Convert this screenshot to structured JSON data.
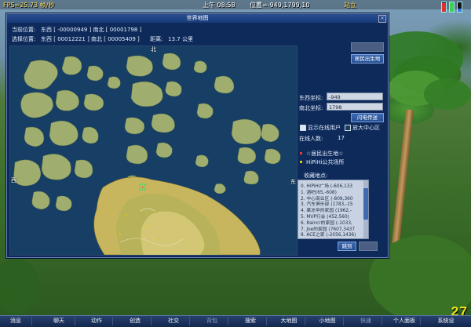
{
  "hud": {
    "fps": "FPS=25.73 帧/秒",
    "time": "上午 08:58",
    "position": "位置=-949,1799,10",
    "status": "站立",
    "corner_number": "27",
    "meters": [
      {
        "color": "#e23030",
        "level": 0.9
      },
      {
        "color": "#3ad050",
        "level": 1.0
      },
      {
        "color": "#3a78e0",
        "level": 0.3
      }
    ]
  },
  "dialog": {
    "title": "世界地图",
    "close": "×",
    "current_position": "当前位置:   东西 [ -00000949 ] 南北 [ 00001798 ]",
    "selected_position": "选择位置:   东西 [ 00012221 ] 南北 [ 00005409 ]      距离:   13.7 公里",
    "compass": {
      "north": "北",
      "west": "西",
      "east": "东"
    },
    "buttons": {
      "top_disabled": "",
      "residence": "居民出生地",
      "teleport": "闪电传送",
      "jump": "跳到",
      "bottom_disabled": ""
    },
    "east_west_label": "东西坐标:",
    "east_west_value": "-949",
    "north_south_label": "南北坐标:",
    "north_south_value": "1798",
    "show_online_label": "显示在线用户",
    "zoom_center_label": "放大中心区",
    "online_count_label": "在线人数:",
    "online_count": "17",
    "legend": [
      {
        "text": "☆居民出生地☆",
        "color": "#e04030"
      },
      {
        "text": "HiPiHi公共场所",
        "color": "#d8c820"
      }
    ],
    "favorites_title": "收藏地点:",
    "favorites": [
      "0.  HiPiHi广场 (-606,133",
      "1.  酒吧(65,-608)",
      "2.  中心商业区 (-809,360",
      "3.  汽车俱乐部 (1783,-15",
      "4.  果冻甲的家园 (1962,-",
      "5.  MVP行会 (452,560)",
      "6.  Raincr的家园 (-1033,",
      "7.  Joe的家园 (7607,3437",
      "8.  ACE之家 (-2056,1436)"
    ]
  },
  "taskbar": [
    {
      "label": "消息",
      "dim": false
    },
    {
      "label": "聊天",
      "dim": false
    },
    {
      "label": "动作",
      "dim": false
    },
    {
      "label": "创造",
      "dim": false
    },
    {
      "label": "社交",
      "dim": false
    },
    {
      "label": "背包",
      "dim": true
    },
    {
      "label": "搜索",
      "dim": false
    },
    {
      "label": "大地图",
      "dim": false
    },
    {
      "label": "小地图",
      "dim": false
    },
    {
      "label": "快速",
      "dim": true
    },
    {
      "label": "个人面板",
      "dim": false
    },
    {
      "label": "系统设",
      "dim": false
    }
  ]
}
